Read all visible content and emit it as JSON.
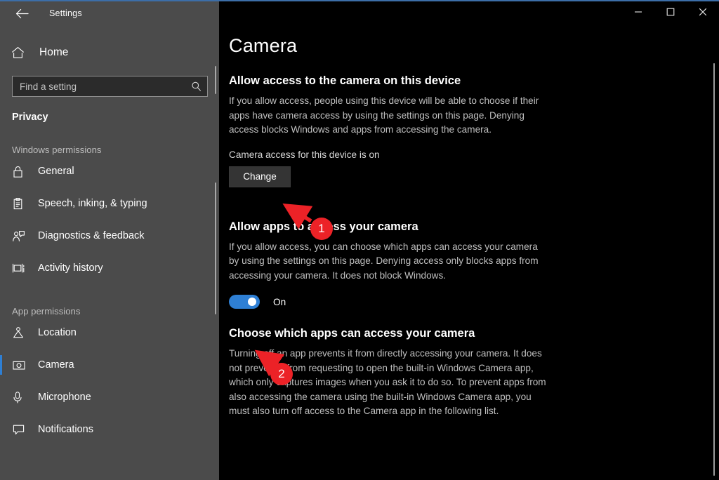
{
  "window": {
    "title": "Settings",
    "back_icon": "back-arrow-icon",
    "controls": [
      {
        "name": "minimize-button",
        "glyph": "─"
      },
      {
        "name": "maximize-button",
        "glyph": "□"
      },
      {
        "name": "close-button",
        "glyph": "✕"
      }
    ]
  },
  "sidebar": {
    "home": {
      "label": "Home",
      "icon": "home-icon"
    },
    "search": {
      "placeholder": "Find a setting",
      "value": "",
      "icon": "search-icon"
    },
    "category": "Privacy",
    "groups": [
      {
        "heading": "Windows permissions",
        "items": [
          {
            "label": "General",
            "icon": "lock-icon",
            "selected": false
          },
          {
            "label": "Speech, inking, & typing",
            "icon": "clipboard-icon",
            "selected": false
          },
          {
            "label": "Diagnostics & feedback",
            "icon": "person-feedback-icon",
            "selected": false
          },
          {
            "label": "Activity history",
            "icon": "timeline-icon",
            "selected": false
          }
        ]
      },
      {
        "heading": "App permissions",
        "items": [
          {
            "label": "Location",
            "icon": "location-pin-icon",
            "selected": false
          },
          {
            "label": "Camera",
            "icon": "camera-icon",
            "selected": true
          },
          {
            "label": "Microphone",
            "icon": "microphone-icon",
            "selected": false
          },
          {
            "label": "Notifications",
            "icon": "notification-icon",
            "selected": false
          }
        ]
      }
    ]
  },
  "main": {
    "page_title": "Camera",
    "section_device": {
      "heading": "Allow access to the camera on this device",
      "body": "If you allow access, people using this device will be able to choose if their apps have camera access by using the settings on this page. Denying access blocks Windows and apps from accessing the camera.",
      "status": "Camera access for this device is on",
      "button_label": "Change"
    },
    "section_apps": {
      "heading": "Allow apps to access your camera",
      "body": "If you allow access, you can choose which apps can access your camera by using the settings on this page. Denying access only blocks apps from accessing your camera. It does not block Windows.",
      "toggle_state": "On",
      "toggle_on": true
    },
    "section_choose": {
      "heading": "Choose which apps can access your camera",
      "body": "Turning off an app prevents it from directly accessing your camera. It does not prevent it from requesting to open the built-in Windows Camera app, which only captures images when you ask it to do so. To prevent apps from also accessing the camera using the built-in Windows Camera app, you must also turn off access to the Camera app in the following list."
    }
  },
  "annotations": [
    {
      "label": "1",
      "target": "change-button"
    },
    {
      "label": "2",
      "target": "camera-apps-toggle"
    }
  ],
  "colors": {
    "accent_blue": "#2e7fd4",
    "annotation_red": "#ec2227",
    "sidebar_bg": "#4b4b4b",
    "main_bg": "#000000",
    "window_border": "#3c6ea8"
  }
}
